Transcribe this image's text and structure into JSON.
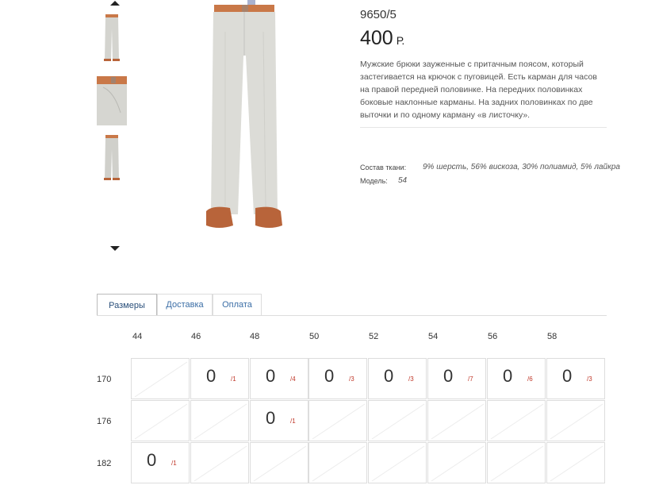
{
  "gallery": {
    "thumbnails": [
      "trousers-front-thumbnail",
      "waistband-closeup-thumbnail",
      "trousers-full-thumbnail"
    ]
  },
  "product": {
    "sku": "9650/5",
    "price": "400",
    "currency": "Р.",
    "description": "Мужские брюки зауженные с притачным поясом, который застегивается на крючок с пуговицей. Есть карман для часов на правой передней половинке. На передних половинках боковые наклонные карманы. На задних половинках по две выточки и по одному карману «в листочку».",
    "fabric_label": "Состав ткани:",
    "fabric_value": "9% шерсть, 56% вискоза, 30% полиамид, 5% лайкра",
    "model_label": "Модель:",
    "model_value": "54"
  },
  "tabs": [
    "Размеры",
    "Доставка",
    "Оплата"
  ],
  "sizes": {
    "columns": [
      "44",
      "46",
      "48",
      "50",
      "52",
      "54",
      "56",
      "58"
    ],
    "rows": [
      {
        "height": "170",
        "cells": [
          null,
          {
            "qty": "0",
            "code": "/1"
          },
          {
            "qty": "0",
            "code": "/4"
          },
          {
            "qty": "0",
            "code": "/3"
          },
          {
            "qty": "0",
            "code": "/3"
          },
          {
            "qty": "0",
            "code": "/7"
          },
          {
            "qty": "0",
            "code": "/6"
          },
          {
            "qty": "0",
            "code": "/3"
          }
        ]
      },
      {
        "height": "176",
        "cells": [
          null,
          null,
          {
            "qty": "0",
            "code": "/1"
          },
          null,
          null,
          null,
          null,
          null
        ]
      },
      {
        "height": "182",
        "cells": [
          {
            "qty": "0",
            "code": "/1"
          },
          null,
          null,
          null,
          null,
          null,
          null,
          null
        ]
      }
    ]
  },
  "colors": {
    "accent_tab": "#3b6ea6",
    "code_red": "#c0392b"
  }
}
